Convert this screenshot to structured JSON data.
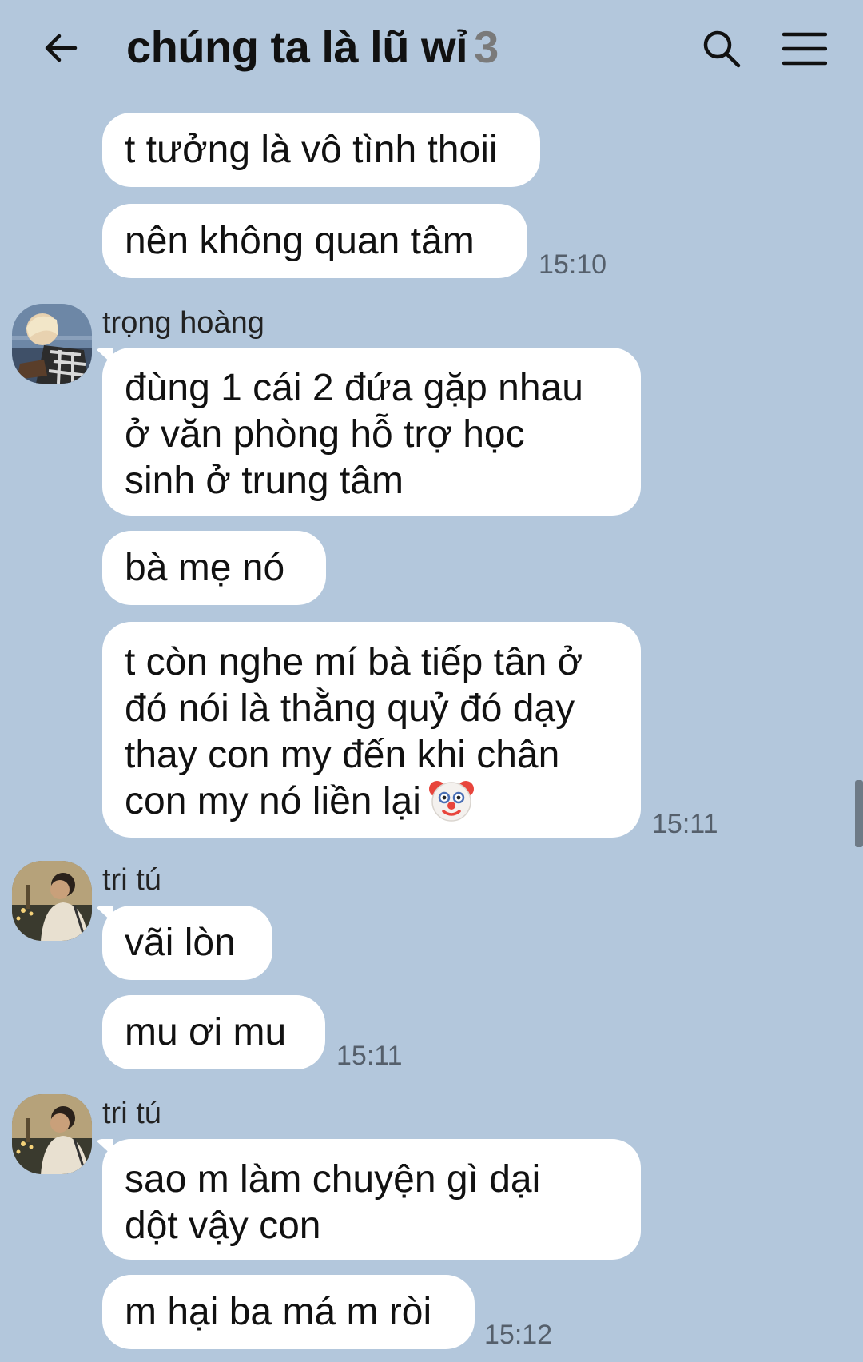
{
  "header": {
    "title": "chúng ta là lũ wỉ",
    "member_count": "3"
  },
  "messages": {
    "m1": "t tưởng là vô tình thoii",
    "m2": "nên không quan tâm",
    "t1": "15:10",
    "sender1": "trọng hoàng",
    "m3": "đùng 1 cái 2 đứa gặp nhau\nở văn phòng hỗ trợ học\nsinh ở trung tâm",
    "m4": "bà mẹ nó",
    "m5": "t còn nghe mí bà tiếp tân ở\nđó nói là thằng quỷ đó dạy\nthay con my đến khi chân\ncon my nó liền lại",
    "t2": "15:11",
    "sender2": "tri tú",
    "m6": "vãi lòn",
    "m7": "mu ơi mu",
    "t3": "15:11",
    "sender3": "tri tú",
    "m8": "sao m làm chuyện gì dại\ndột vậy con",
    "m9": "m hại ba má m ròi",
    "t4": "15:12"
  },
  "icons": {
    "back": "arrow-left-icon",
    "search": "search-icon",
    "menu": "hamburger-menu-icon",
    "emoji": "clown-face-emoji"
  },
  "colors": {
    "background": "#b3c7dc",
    "bubble": "#ffffff",
    "timestamp": "#555f6b"
  }
}
